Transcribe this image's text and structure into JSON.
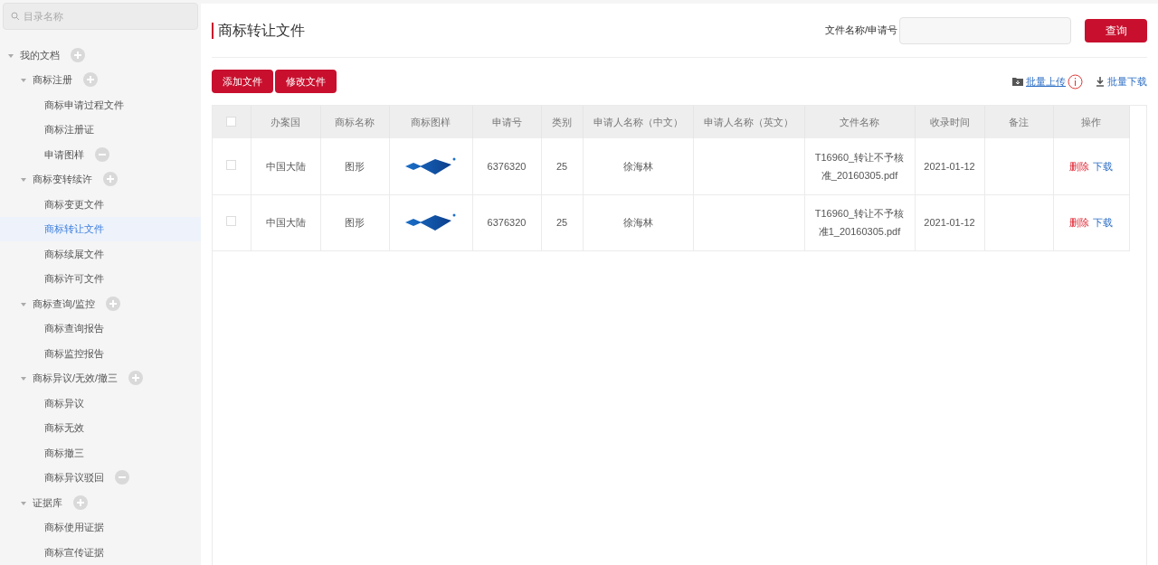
{
  "sidebar": {
    "search": {
      "placeholder": "目录名称"
    },
    "tree": [
      {
        "label": "我的文档",
        "kind": "group",
        "expanded": true,
        "selected": false,
        "children": [
          {
            "label": "商标注册",
            "kind": "group",
            "expanded": true,
            "selected": false,
            "children": [
              {
                "label": "商标申请过程文件",
                "kind": "leaf",
                "selected": false
              },
              {
                "label": "商标注册证",
                "kind": "leaf",
                "selected": false
              },
              {
                "label": "申请图样",
                "kind": "removable",
                "selected": false
              }
            ]
          },
          {
            "label": "商标变转续许",
            "kind": "group",
            "expanded": true,
            "selected": false,
            "children": [
              {
                "label": "商标变更文件",
                "kind": "leaf",
                "selected": false
              },
              {
                "label": "商标转让文件",
                "kind": "leaf",
                "selected": true
              },
              {
                "label": "商标续展文件",
                "kind": "leaf",
                "selected": false
              },
              {
                "label": "商标许可文件",
                "kind": "leaf",
                "selected": false
              }
            ]
          },
          {
            "label": "商标查询/监控",
            "kind": "group",
            "expanded": true,
            "selected": false,
            "children": [
              {
                "label": "商标查询报告",
                "kind": "leaf",
                "selected": false
              },
              {
                "label": "商标监控报告",
                "kind": "leaf",
                "selected": false
              }
            ]
          },
          {
            "label": "商标异议/无效/撤三",
            "kind": "group",
            "expanded": true,
            "selected": false,
            "children": [
              {
                "label": "商标异议",
                "kind": "leaf",
                "selected": false
              },
              {
                "label": "商标无效",
                "kind": "leaf",
                "selected": false
              },
              {
                "label": "商标撤三",
                "kind": "leaf",
                "selected": false
              },
              {
                "label": "商标异议驳回",
                "kind": "removable",
                "selected": false
              }
            ]
          },
          {
            "label": "证据库",
            "kind": "group",
            "expanded": true,
            "selected": false,
            "children": [
              {
                "label": "商标使用证据",
                "kind": "leaf",
                "selected": false
              },
              {
                "label": "商标宣传证据",
                "kind": "leaf",
                "selected": false
              }
            ]
          }
        ]
      }
    ]
  },
  "header": {
    "title": "商标转让文件",
    "search_label": "文件名称/申请号",
    "search_button": "查询"
  },
  "toolbar": {
    "buttons": [
      "添加文件",
      "修改文件"
    ],
    "upload": "批量上传",
    "download": "批量下载"
  },
  "table": {
    "header_checked": false,
    "columns": [
      "办案国",
      "商标名称",
      "商标图样",
      "申请号",
      "类别",
      "申请人名称（中文）",
      "申请人名称（英文）",
      "文件名称",
      "收录时间",
      "备注",
      "操作"
    ],
    "rows": [
      {
        "checked": false,
        "country": "中国大陆",
        "name": "图形",
        "number": "6376320",
        "class": "25",
        "applicant_cn": "徐海林",
        "file": "T16960_转让不予核准_20160305.pdf",
        "date": "2021-01-12",
        "delete": "删除",
        "download": "下载"
      },
      {
        "checked": false,
        "country": "中国大陆",
        "name": "图形",
        "number": "6376320",
        "class": "25",
        "applicant_cn": "徐海林",
        "file": "T16960_转让不予核准1_20160305.pdf",
        "date": "2021-01-12",
        "delete": "删除",
        "download": "下载"
      }
    ]
  }
}
